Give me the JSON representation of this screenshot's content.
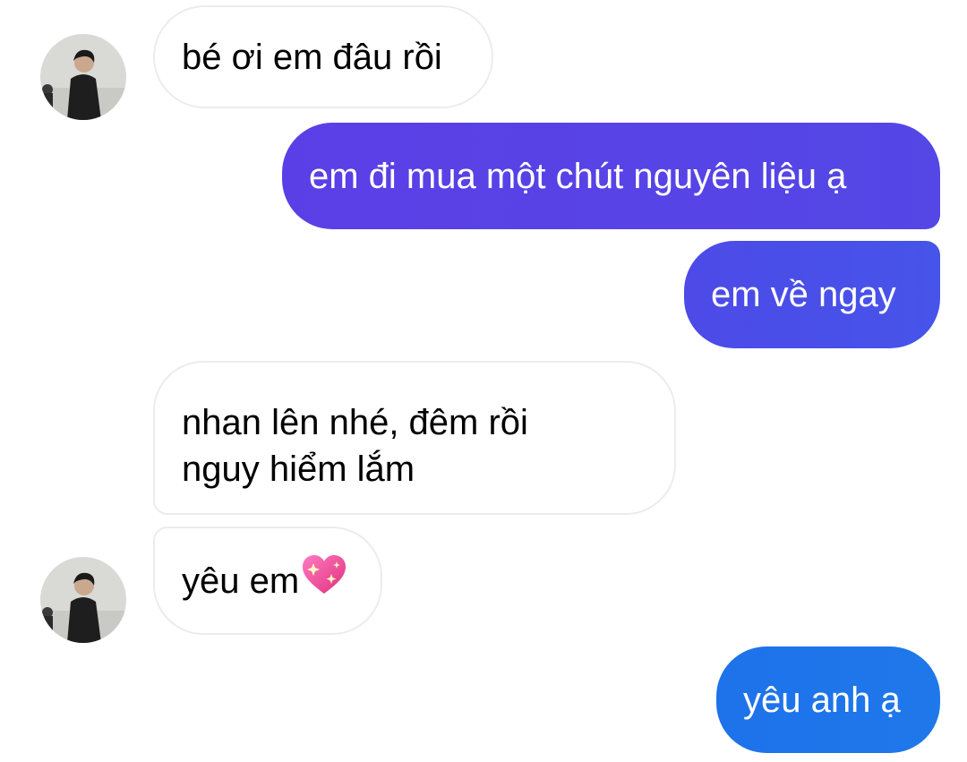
{
  "contact": {
    "avatar_icon": "contact-avatar-icon"
  },
  "colors": {
    "incoming_bg": "#ffffff",
    "incoming_border": "#ececec",
    "outgoing_purple": "#5b3fe6",
    "outgoing_violet": "#4c4fe8",
    "outgoing_blue": "#1f73ea",
    "heart": "#ff4fa0"
  },
  "messages": [
    {
      "direction": "incoming",
      "text": "bé ơi em đâu rồi",
      "show_avatar": true
    },
    {
      "direction": "outgoing",
      "text": "em đi mua một chút nguyên liệu ạ"
    },
    {
      "direction": "outgoing",
      "text": "em về ngay"
    },
    {
      "direction": "incoming",
      "lines": [
        "nhan lên nhé, đêm rồi",
        "nguy hiểm lắm"
      ],
      "show_avatar": false
    },
    {
      "direction": "incoming",
      "text": "yêu em",
      "emoji": "sparkling-heart-icon",
      "show_avatar": true
    },
    {
      "direction": "outgoing",
      "text": "yêu anh ạ"
    }
  ]
}
